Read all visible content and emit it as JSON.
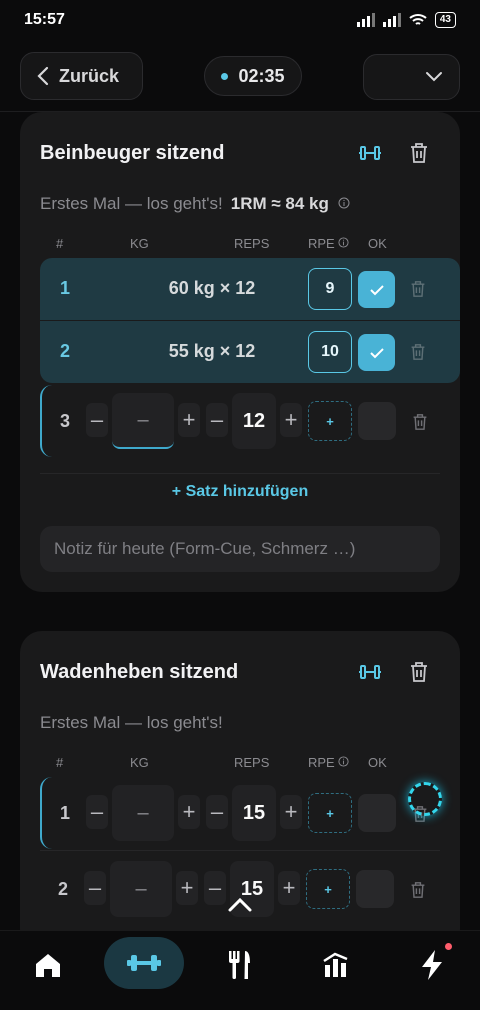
{
  "status": {
    "time": "15:57",
    "battery": "43"
  },
  "header": {
    "back_label": "Zurück",
    "timer": "02:35"
  },
  "exercises": [
    {
      "title": "Beinbeuger sitzend",
      "subtitle": "Erstes Mal — los geht's!",
      "one_rm": "1RM ≈ 84 kg",
      "headers": {
        "num": "#",
        "kg": "KG",
        "reps": "REPS",
        "rpe": "RPE",
        "ok": "OK"
      },
      "sets_done": [
        {
          "num": "1",
          "value": "60 kg × 12",
          "rpe": "9"
        },
        {
          "num": "2",
          "value": "55 kg × 12",
          "rpe": "10"
        }
      ],
      "set_edit": {
        "num": "3",
        "kg": "–",
        "reps": "12",
        "rpe_add": "+"
      },
      "add_set": "Satz hinzufügen",
      "note_placeholder": "Notiz für heute (Form-Cue, Schmerz …)"
    },
    {
      "title": "Wadenheben sitzend",
      "subtitle": "Erstes Mal — los geht's!",
      "headers": {
        "num": "#",
        "kg": "KG",
        "reps": "REPS",
        "rpe": "RPE",
        "ok": "OK"
      },
      "sets": [
        {
          "num": "1",
          "kg": "–",
          "reps": "15",
          "rpe_add": "+"
        },
        {
          "num": "2",
          "kg": "–",
          "reps": "15",
          "rpe_add": "+"
        }
      ]
    }
  ],
  "pm": {
    "minus": "–",
    "plus": "+"
  },
  "colors": {
    "accent": "#5ac8e6",
    "done_row": "#1f3a43",
    "card": "#1a1a1b",
    "background": "#0b0b0c"
  },
  "nav": [
    "home-icon",
    "dumbbell-icon",
    "fork-knife-icon",
    "stats-icon",
    "lightning-icon"
  ]
}
